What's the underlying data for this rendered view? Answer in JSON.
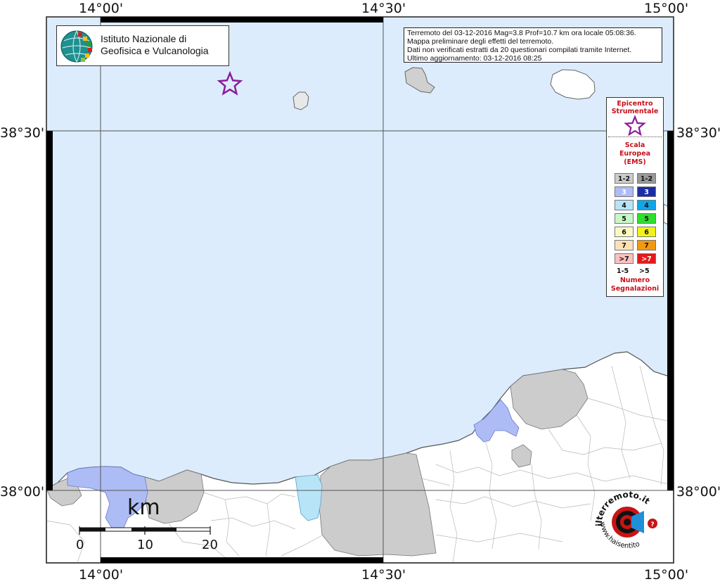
{
  "map": {
    "coords": {
      "top": [
        "14°00'",
        "14°30'",
        "15°00'"
      ],
      "bottom": [
        "14°00'",
        "14°30'",
        "15°00'"
      ],
      "left": [
        "38°30'",
        "38°00'"
      ],
      "right": [
        "38°30'",
        "38°00'"
      ]
    },
    "colors": {
      "sea": "#dcecfc",
      "land": "#ffffff",
      "gray_area": "#cccccc",
      "ems3_light": "#aebcf5",
      "ems4_light": "#b8e4f8",
      "epicenter": "#8b1c9c"
    }
  },
  "logo": {
    "line1": "Istituto Nazionale di",
    "line2": "Geofisica e Vulcanologia"
  },
  "info": {
    "line1": "Terremoto del 03-12-2016 Mag=3.8 Prof=10.7 km ora locale 05:08:36.",
    "line2": "Mappa preliminare degli effetti del terremoto.",
    "line3": "Dati non verificati estratti da 20 questionari compilati tramite Internet.",
    "line4": "Ultimo aggiornamento: 03-12-2016 08:25"
  },
  "legend": {
    "epicenter_line1": "Epicentro",
    "epicenter_line2": "Strumentale",
    "scale_line1": "Scala",
    "scale_line2": "Europea",
    "scale_line3": "(EMS)",
    "rows": [
      {
        "left": "1-2",
        "right": "1-2",
        "left_color": "#cccccc",
        "right_color": "#999999",
        "left_text": "#111111",
        "right_text": "#111111"
      },
      {
        "left": "3",
        "right": "3",
        "left_color": "#aebcf5",
        "right_color": "#1a2ea8",
        "left_text": "#ffffff",
        "right_text": "#ffffff"
      },
      {
        "left": "4",
        "right": "4",
        "left_color": "#b8e4f8",
        "right_color": "#0fa6e8",
        "left_text": "#111111",
        "right_text": "#111111"
      },
      {
        "left": "5",
        "right": "5",
        "left_color": "#c8f8c8",
        "right_color": "#2ee02e",
        "left_text": "#111111",
        "right_text": "#111111"
      },
      {
        "left": "6",
        "right": "6",
        "left_color": "#fafac0",
        "right_color": "#f2f21a",
        "left_text": "#111111",
        "right_text": "#111111"
      },
      {
        "left": "7",
        "right": "7",
        "left_color": "#fce0b8",
        "right_color": "#f29a0f",
        "left_text": "#111111",
        "right_text": "#111111"
      },
      {
        "left": ">7",
        "right": ">7",
        "left_color": "#fcc0c0",
        "right_color": "#e41a1a",
        "left_text": "#111111",
        "right_text": "#ffffff"
      }
    ],
    "count_left": "1-5",
    "count_right": ">5",
    "count_line1": "Numero",
    "count_line2": "Segnalazioni"
  },
  "scalebar": {
    "unit": "km",
    "ticks": [
      "0",
      "10",
      "20"
    ]
  },
  "haisentito": {
    "logo_text": "www.haisentito",
    "brand": "ilterremoto.it"
  }
}
